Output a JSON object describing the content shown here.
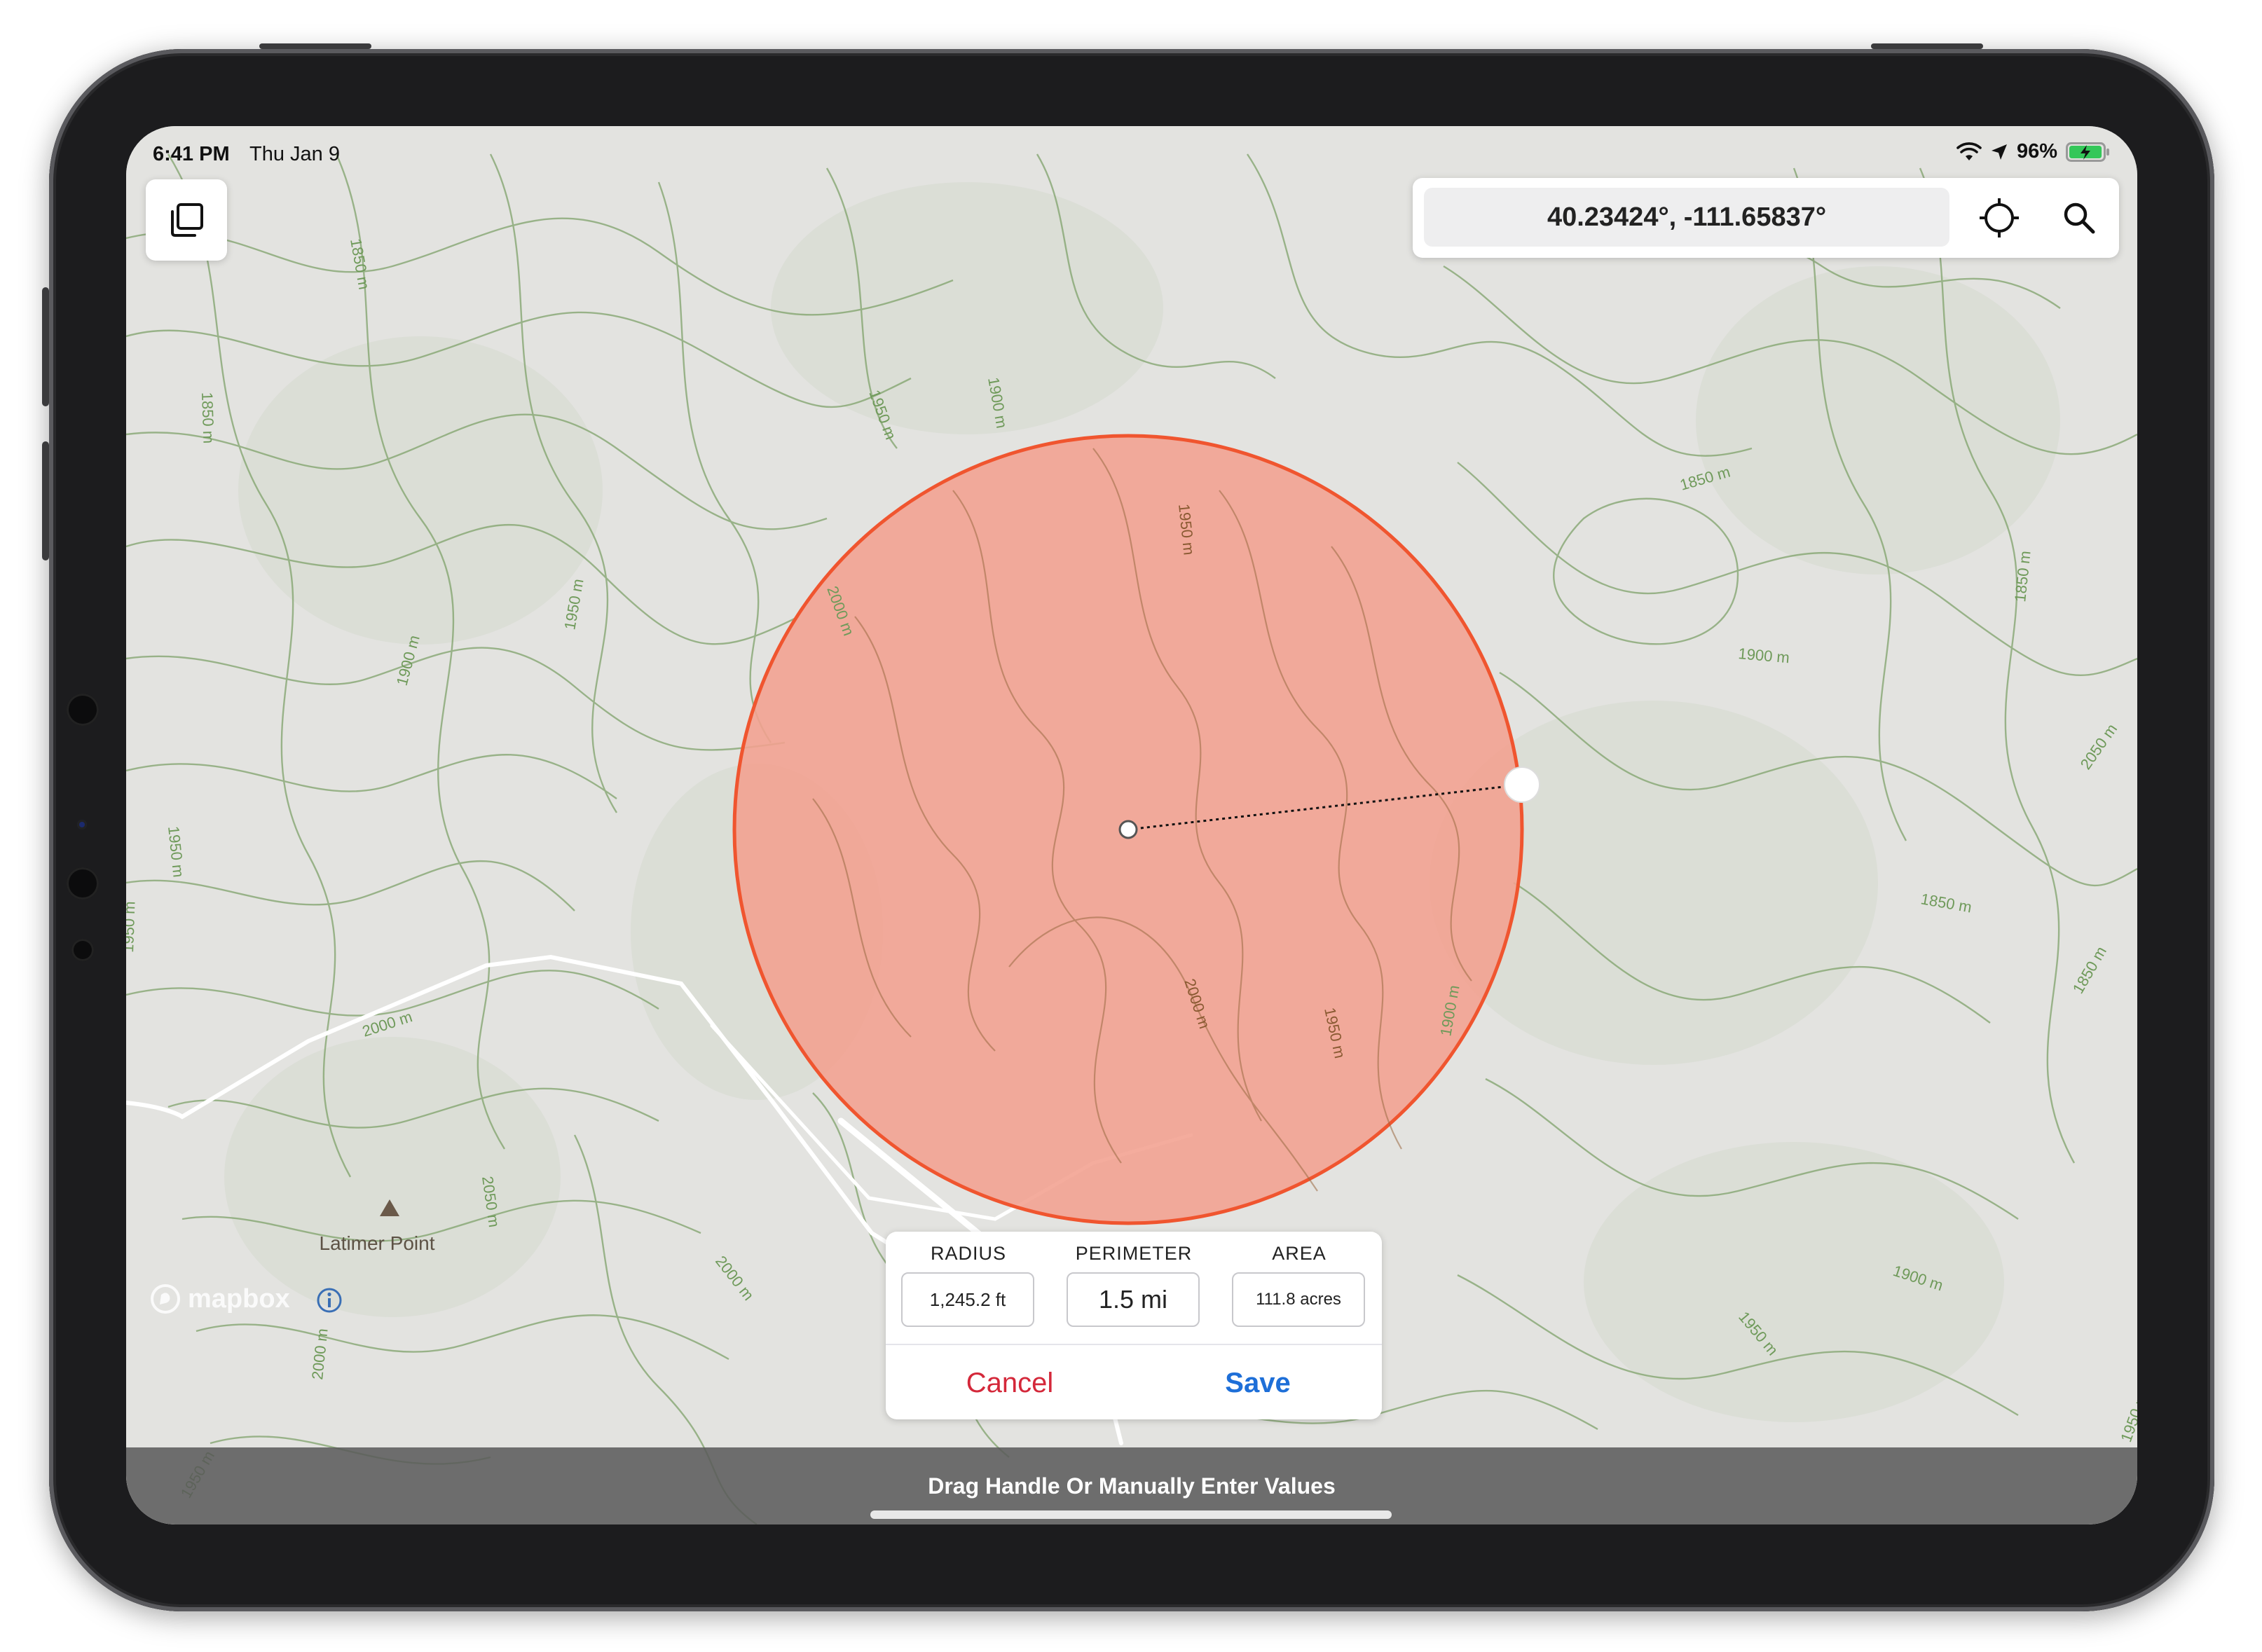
{
  "status_bar": {
    "time": "6:41 PM",
    "date": "Thu Jan 9",
    "battery_percent": "96%",
    "battery_level": 0.96,
    "icons": [
      "wifi-icon",
      "location-arrow-icon",
      "battery-charging-icon"
    ]
  },
  "toolbar": {
    "layers_icon": "layers-icon",
    "coordinates": "40.23424°, -111.65837°",
    "locate_icon": "crosshair-icon",
    "search_icon": "search-icon"
  },
  "map": {
    "place_label": "Latimer Point",
    "attribution": "mapbox",
    "contour_labels": [
      "1850 m",
      "1900 m",
      "1950 m",
      "2000 m",
      "2050 m"
    ],
    "circle_color": "#f0552f",
    "circle_fill": "#f3a090"
  },
  "measure": {
    "radius_label": "RADIUS",
    "radius_value": "1,245.2 ft",
    "perimeter_label": "PERIMETER",
    "perimeter_value": "1.5 mi",
    "area_label": "AREA",
    "area_value": "111.8 acres",
    "cancel_label": "Cancel",
    "save_label": "Save"
  },
  "hint": "Drag Handle Or Manually Enter Values",
  "colors": {
    "cancel": "#d4283a",
    "save": "#1e6fd8",
    "contour": "#6f9a5a",
    "battery": "#34c759"
  }
}
